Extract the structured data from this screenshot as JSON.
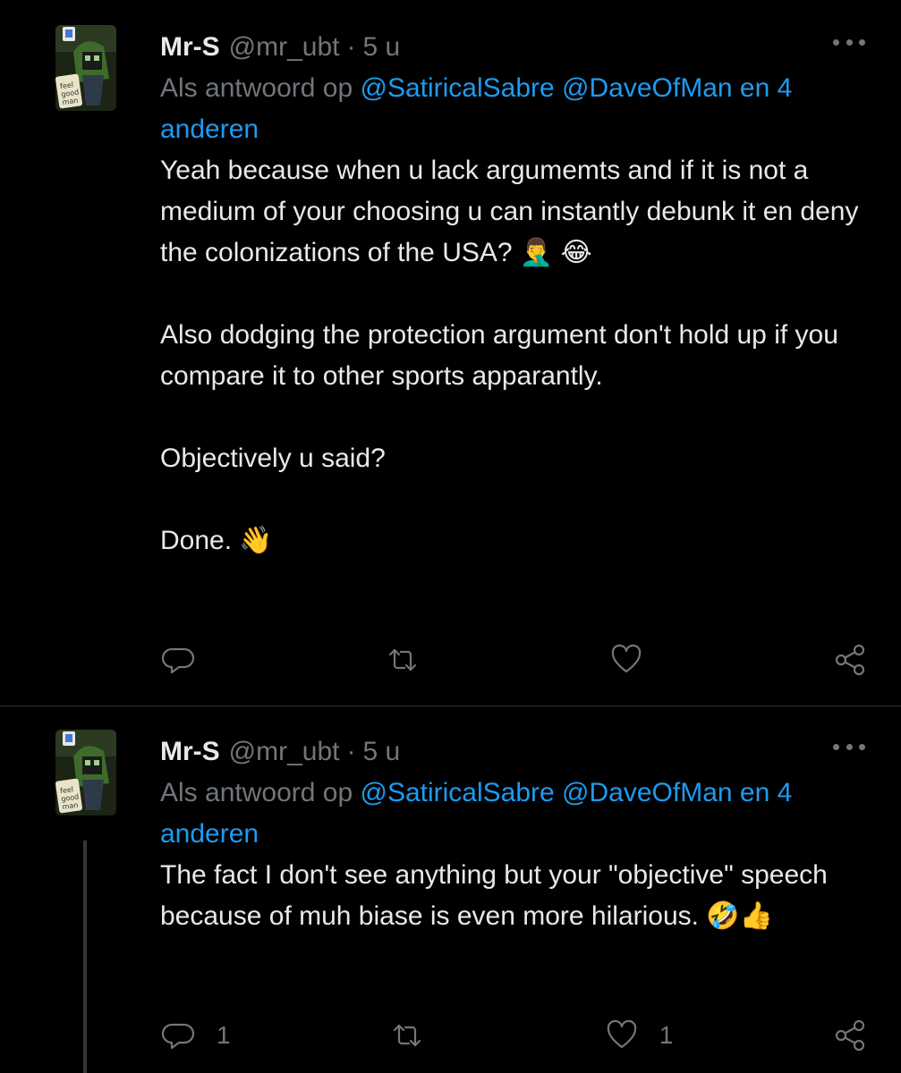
{
  "colors": {
    "background": "#000000",
    "text": "#e7e9ea",
    "muted": "#71767b",
    "link": "#1d9bf0",
    "divider": "#2f3336"
  },
  "tweets": [
    {
      "name": "Mr-S",
      "handle": "@mr_ubt",
      "separator": "·",
      "time": "5 u",
      "reply_prefix": "Als antwoord op",
      "mention_1": "@SatiricalSabre",
      "mention_2": "@DaveOfMan",
      "reply_and": "en",
      "reply_others": "4 anderen",
      "paragraphs": [
        "Yeah because when u lack argumemts and if it is not a medium of your choosing u can instantly debunk it en deny the colonizations of the USA? 🤦‍♂️ 😂",
        "Also dodging the protection argument don't hold up if you compare it to other sports apparantly.",
        "Objectively u said?",
        "Done. 👋"
      ],
      "reply_count": "",
      "retweet_count": "",
      "like_count": "",
      "icons": [
        "reply-icon",
        "retweet-icon",
        "like-icon",
        "share-icon"
      ]
    },
    {
      "name": "Mr-S",
      "handle": "@mr_ubt",
      "separator": "·",
      "time": "5 u",
      "reply_prefix": "Als antwoord op",
      "mention_1": "@SatiricalSabre",
      "mention_2": "@DaveOfMan",
      "reply_and": "en",
      "reply_others": "4 anderen",
      "paragraphs": [
        "The fact I don't see anything but your \"objective\" speech because of muh biase is even more hilarious. 🤣👍"
      ],
      "reply_count": "1",
      "retweet_count": "",
      "like_count": "1",
      "icons": [
        "reply-icon",
        "retweet-icon",
        "like-icon",
        "share-icon"
      ]
    }
  ]
}
